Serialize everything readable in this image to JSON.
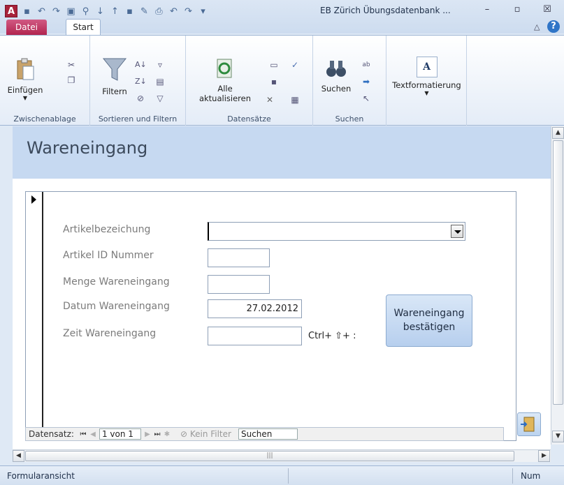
{
  "titlebar": {
    "app_icon": "A",
    "title": "EB Zürich Übungsdatenbank ...",
    "minimize": "–",
    "maximize": "▫",
    "close": "☒"
  },
  "tabs": {
    "file": "Datei",
    "start": "Start"
  },
  "ribbon": {
    "clipboard": {
      "paste": "Einfügen",
      "group": "Zwischenablage"
    },
    "sort_filter": {
      "filter": "Filtern",
      "group": "Sortieren und Filtern"
    },
    "records": {
      "refresh_line1": "Alle",
      "refresh_line2": "aktualisieren",
      "group": "Datensätze"
    },
    "find": {
      "search": "Suchen",
      "group": "Suchen"
    },
    "text": {
      "format": "Textformatierung",
      "glyph": "A"
    }
  },
  "form": {
    "title": "Wareneingang",
    "labels": {
      "article": "Artikelbezeichung",
      "article_id": "Artikel ID Nummer",
      "quantity": "Menge Wareneingang",
      "date": "Datum Wareneingang",
      "time": "Zeit Wareneingang"
    },
    "values": {
      "article": "",
      "article_id": "",
      "quantity": "",
      "date": "27.02.2012",
      "time": ""
    },
    "time_hint": "Ctrl+  ⇧+  :",
    "confirm_line1": "Wareneingang",
    "confirm_line2": "bestätigen"
  },
  "navbar": {
    "label": "Datensatz:",
    "record": "1 von 1",
    "filter": "Kein Filter",
    "search": "Suchen"
  },
  "statusbar": {
    "view": "Formularansicht",
    "num": "Num"
  },
  "colors": {
    "header_bg": "#c6d9f1",
    "file_tab": "#b2244f",
    "button_bg": "#b7cfee"
  }
}
